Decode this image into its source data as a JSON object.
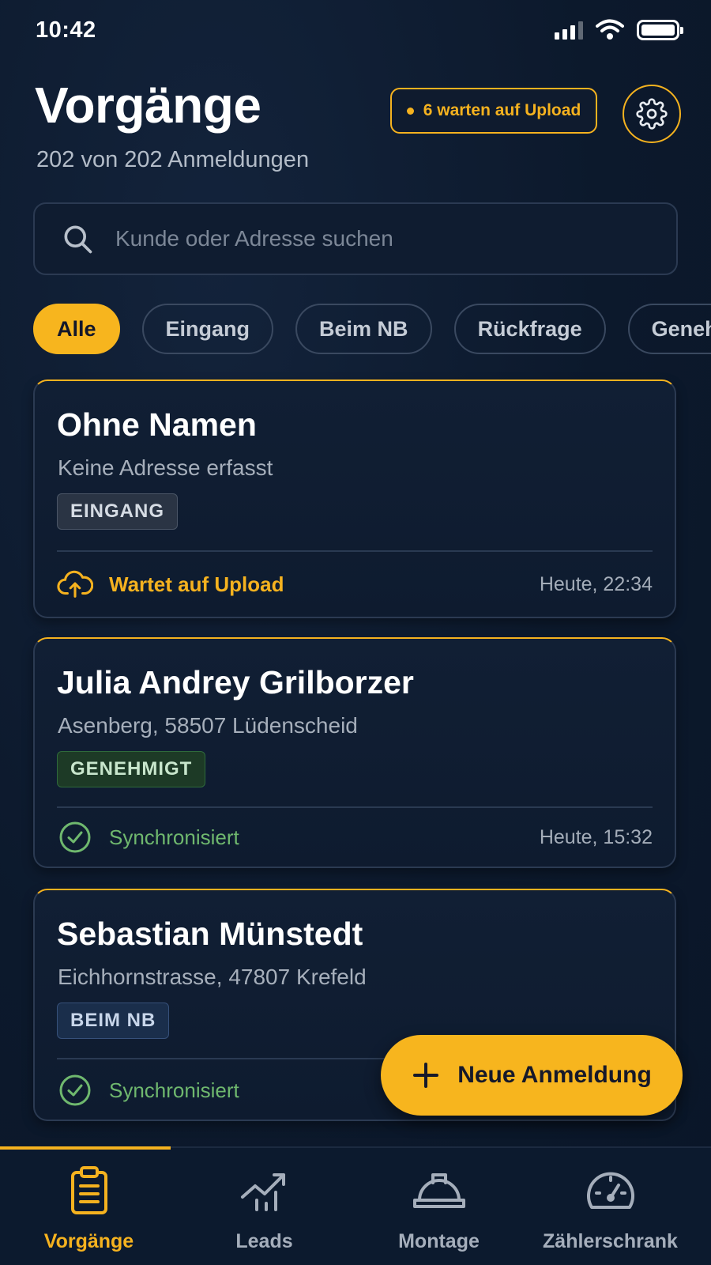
{
  "status_bar": {
    "time": "10:42"
  },
  "header": {
    "title": "Vorgänge",
    "subtitle": "202 von 202 Anmeldungen",
    "upload_pill": "6 warten auf Upload",
    "settings_icon": "gear-icon"
  },
  "search": {
    "placeholder": "Kunde oder Adresse suchen"
  },
  "filters": [
    {
      "label": "Alle",
      "active": true
    },
    {
      "label": "Eingang",
      "active": false
    },
    {
      "label": "Beim NB",
      "active": false
    },
    {
      "label": "Rückfrage",
      "active": false
    },
    {
      "label": "Genehm",
      "active": false
    }
  ],
  "cards": [
    {
      "name": "Ohne Namen",
      "address": "Keine Adresse erfasst",
      "badge": "EINGANG",
      "sync_status": "Wartet auf Upload",
      "sync_icon": "cloud-upload-icon",
      "time": "Heute, 22:34"
    },
    {
      "name": "Julia Andrey Grilborzer",
      "address": "Asenberg, 58507 Lüdenscheid",
      "badge": "GENEHMIGT",
      "sync_status": "Synchronisiert",
      "sync_icon": "check-circle-icon",
      "time": "Heute, 15:32"
    },
    {
      "name": "Sebastian Münstedt",
      "address": "Eichhornstrasse, 47807 Krefeld",
      "badge": "BEIM NB",
      "sync_status": "Synchronisiert",
      "sync_icon": "check-circle-icon",
      "time": ""
    }
  ],
  "fab": {
    "label": "Neue Anmeldung",
    "icon": "plus-icon"
  },
  "tabbar": [
    {
      "label": "Vorgänge",
      "icon": "clipboard-icon",
      "active": true
    },
    {
      "label": "Leads",
      "icon": "trend-chart-icon",
      "active": false
    },
    {
      "label": "Montage",
      "icon": "hard-hat-icon",
      "active": false
    },
    {
      "label": "Zählerschrank",
      "icon": "gauge-icon",
      "active": false
    }
  ],
  "colors": {
    "accent": "#f5b21f",
    "background": "#0c192c",
    "success": "#6fb86e"
  }
}
